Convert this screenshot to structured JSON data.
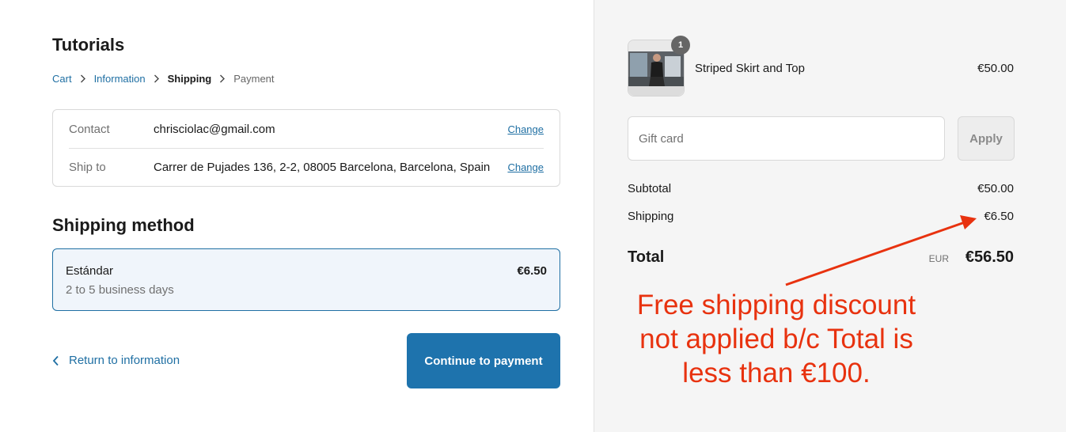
{
  "store": {
    "title": "Tutorials"
  },
  "breadcrumb": {
    "cart": "Cart",
    "information": "Information",
    "shipping": "Shipping",
    "payment": "Payment",
    "separator_icon": "chevron-right-icon"
  },
  "review": {
    "contact": {
      "label": "Contact",
      "value": "chrisciolac@gmail.com",
      "change": "Change"
    },
    "ship_to": {
      "label": "Ship to",
      "value": "Carrer de Pujades 136, 2-2, 08005 Barcelona, Barcelona, Spain",
      "change": "Change"
    }
  },
  "shipping_method": {
    "heading": "Shipping method",
    "option": {
      "name": "Estándar",
      "days": "2 to 5 business days",
      "price": "€6.50",
      "selected": true
    }
  },
  "navigation": {
    "return_label": "Return to information",
    "continue_label": "Continue to payment"
  },
  "order": {
    "item": {
      "name": "Striped Skirt and Top",
      "price": "€50.00",
      "quantity": "1"
    },
    "gift_card": {
      "placeholder": "Gift card",
      "apply_label": "Apply"
    },
    "subtotal": {
      "label": "Subtotal",
      "value": "€50.00"
    },
    "shipping": {
      "label": "Shipping",
      "value": "€6.50"
    },
    "total": {
      "label": "Total",
      "currency": "EUR",
      "value": "€56.50"
    }
  },
  "annotation": {
    "lines": [
      "Free shipping discount",
      "not applied b/c Total is",
      "less than €100."
    ],
    "color": "#e8320f"
  },
  "colors": {
    "accent": "#1e73ad",
    "link": "#1f6fa3",
    "sidebar_bg": "#f5f5f5"
  }
}
